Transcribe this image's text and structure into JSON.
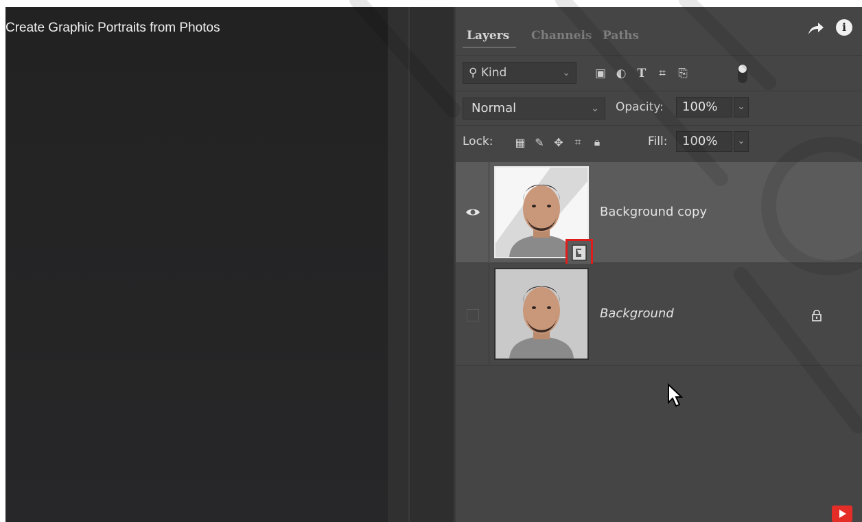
{
  "video": {
    "title": "Create Graphic Portraits from Photos"
  },
  "panel": {
    "tabs": [
      {
        "label": "Layers",
        "active": true
      },
      {
        "label": "Channels",
        "active": false
      },
      {
        "label": "Paths",
        "active": false
      }
    ],
    "filter": {
      "search_label": "Kind",
      "icons": [
        "image-filter-icon",
        "adjustment-filter-icon",
        "type-filter-icon",
        "shape-filter-icon",
        "smart-object-filter-icon"
      ]
    },
    "blend_mode": "Normal",
    "opacity_label": "Opacity:",
    "opacity_value": "100%",
    "lock_label": "Lock:",
    "fill_label": "Fill:",
    "fill_value": "100%",
    "layers": [
      {
        "name": "Background copy",
        "visible": true,
        "selected": true,
        "smart_object": true
      },
      {
        "name": "Background",
        "visible": false,
        "selected": false,
        "locked": true
      }
    ]
  },
  "colors": {
    "panel_bg": "#454545",
    "selected_row": "#5b5b5b",
    "highlight_red": "#e21b1b",
    "youtube_red": "#e52d27"
  }
}
